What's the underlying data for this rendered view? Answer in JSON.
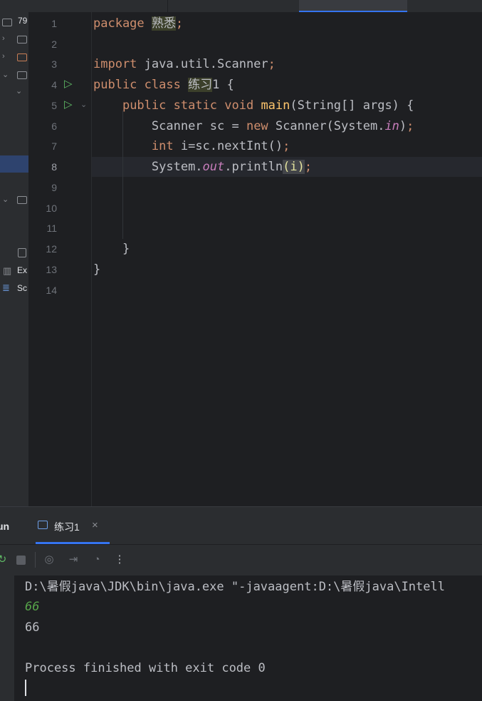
{
  "project_tree": {
    "root_label": "79",
    "bottom_items": [
      {
        "label": "Ex"
      },
      {
        "label": "Sc"
      }
    ]
  },
  "editor": {
    "line_numbers": [
      "1",
      "2",
      "3",
      "4",
      "5",
      "6",
      "7",
      "8",
      "9",
      "10",
      "11",
      "12",
      "13",
      "14"
    ],
    "current_line": "8",
    "code": {
      "l1_kw": "package",
      "l1_pkg": "熟悉",
      "l1_semi": ";",
      "l3_kw": "import",
      "l3_rest": " java.util.Scanner",
      "l3_semi": ";",
      "l4_kw": "public class",
      "l4_cls": "练习",
      "l4_rest": "1 {",
      "l5_kw": "public static void",
      "l5_fn": "main",
      "l5_rest": "(String[] args) {",
      "l6_a": "Scanner sc = ",
      "l6_kw": "new",
      "l6_b": " Scanner(System.",
      "l6_static": "in",
      "l6_c": ")",
      "l6_semi": ";",
      "l7_kw": "int",
      "l7_rest": " i=sc.nextInt()",
      "l7_semi": ";",
      "l8_a": "System.",
      "l8_static": "out",
      "l8_b": ".println",
      "l8_paren": "(i)",
      "l8_semi": ";",
      "l12": "}",
      "l13": "}"
    }
  },
  "run_panel": {
    "title": "un",
    "tab_label": "练习1",
    "tab_close": "×",
    "toolbar_more": "⋮",
    "console": {
      "command": "D:\\暑假java\\JDK\\bin\\java.exe \"-javaagent:D:\\暑假java\\Intell",
      "input_echo": "66",
      "output": "66",
      "exit": "Process finished with exit code 0"
    }
  },
  "colors": {
    "keyword": "#cf8e6d",
    "function": "#56a8f5",
    "static_field": "#c77dbb",
    "console_input": "#57a64a",
    "accent": "#3574f0"
  }
}
